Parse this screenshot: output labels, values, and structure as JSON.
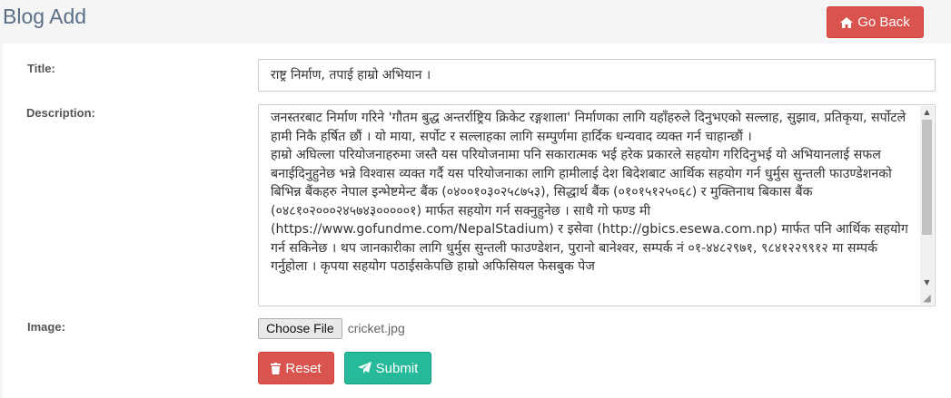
{
  "header": {
    "title": "Blog Add",
    "go_back_label": "Go Back"
  },
  "form": {
    "title_label": "Title:",
    "title_value": "राष्ट्र निर्माण, तपाई हाम्रो अभियान ।",
    "description_label": "Description:",
    "description_value": "जनस्तरबाट निर्माण गरिने 'गौतम बुद्ध अन्तर्राष्ट्रिय क्रिकेट रङ्गशाला' निर्माणका लागि यहाँहरुले दिनुभएको सल्लाह, सुझाव, प्रतिकृया, सर्पोटले हामी निकै हर्षित छौं । यो माया, सर्पोट र सल्लाहका लागि सम्पुर्णमा हार्दिक धन्यवाद व्यक्त गर्न चाहान्छौं ।\nहाम्रो अघिल्ला परियोजनाहरुमा जस्तै यस परियोजनामा पनि सकारात्मक भई हरेक प्रकारले सहयोग गरिदिनुभई यो अभियानलाई सफल बनाईदिनुहुनेछ भन्ने विश्वास व्यक्त गर्दै यस परियोजनाका लागि हामीलाई देश बिदेशबाट आर्थिक सहयोग गर्न धुर्मुस सुन्तली फाउण्डेशनको बिभिन्न बैंकहरु नेपाल इन्भेष्टमेन्ट बैंक (०४००१०३०२५८७५३), सिद्धार्थ बैंक (०१०१५१२५०६८) र मुक्तिनाथ बिकास बैंक (०४८१०२०००२४५७४३०००००१) मार्फत सहयोग गर्न सक्नुहुनेछ । साथै गो फण्ड मी (https://www.gofundme.com/NepalStadium) र इसेवा (http://gbics.esewa.com.np) मार्फत पनि आर्थिक सहयोग गर्न सकिनेछ । थप जानकारीका लागि धुर्मुस सुन्तली फाउण्डेशन, पुरानो बानेश्वर, सम्पर्क नं ०१-४४८२९७१, ९८४१२२९९१२ मा सम्पर्क गर्नुहोला । कृपया सहयोग पठाईसकेपछि हाम्रो अफिसियल फेसबुक पेज",
    "image_label": "Image:",
    "choose_file_label": "Choose File",
    "file_name": "cricket.jpg",
    "reset_label": "Reset",
    "submit_label": "Submit"
  },
  "icons": {
    "go_back": "home-icon",
    "reset": "trash-icon",
    "submit": "paper-plane-icon"
  },
  "colors": {
    "danger": "#d9534f",
    "success": "#26b99a",
    "title": "#5a6f86"
  }
}
